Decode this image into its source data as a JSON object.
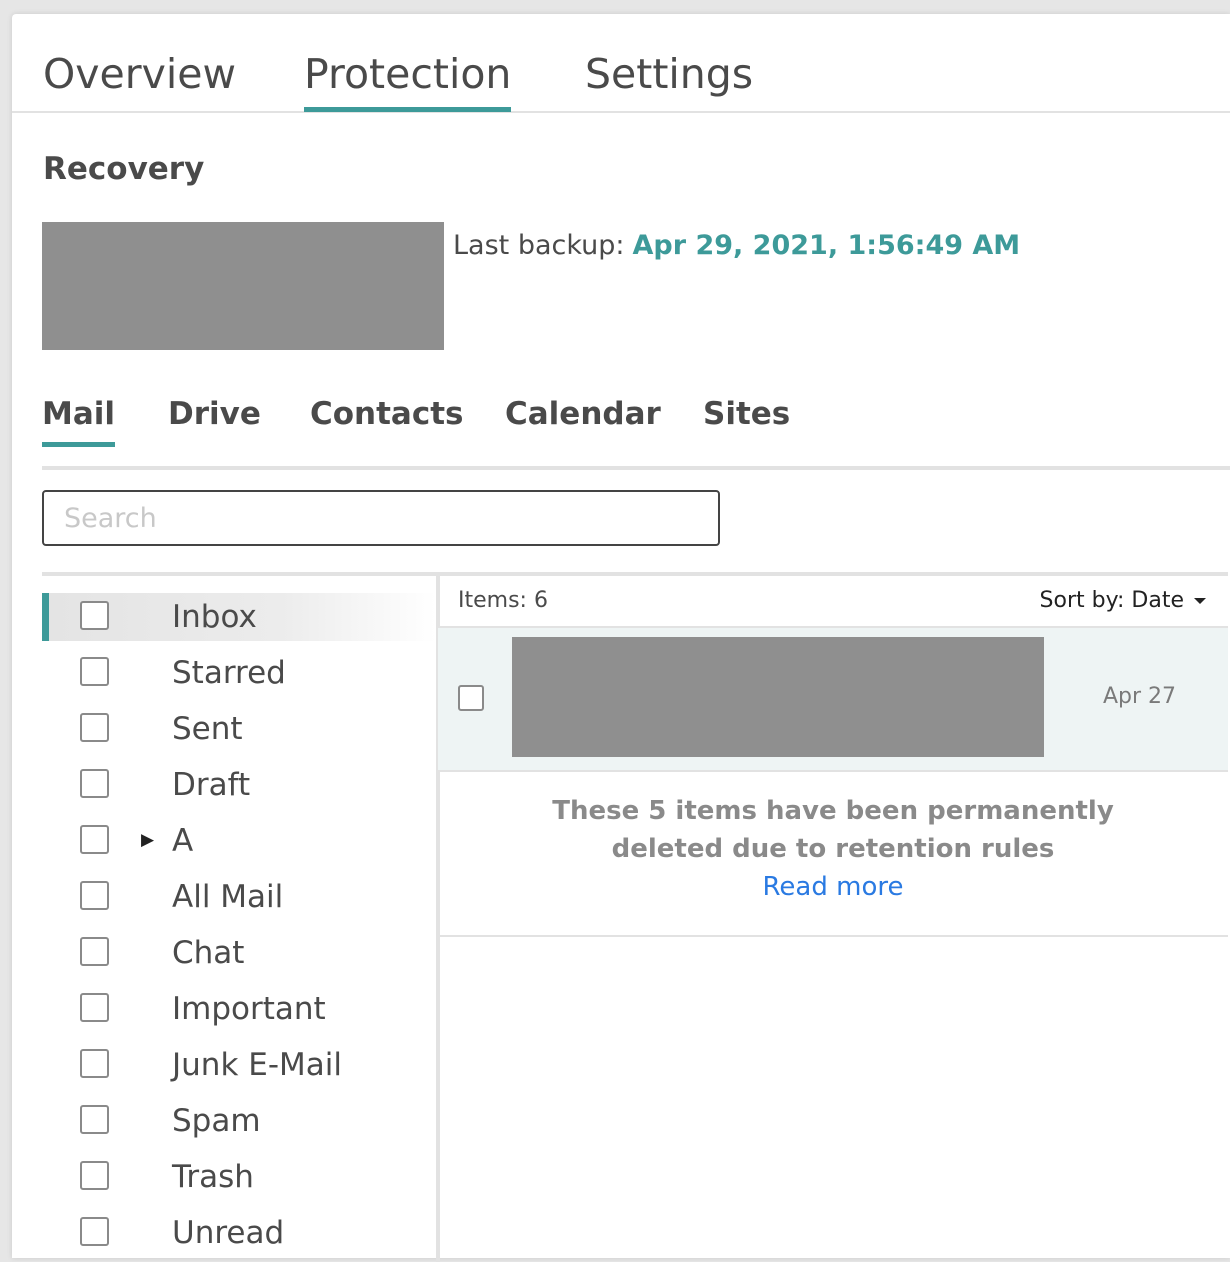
{
  "tabs": [
    "Overview",
    "Protection",
    "Settings"
  ],
  "active_tab": "Protection",
  "section_title": "Recovery",
  "last_backup": {
    "label": "Last backup:",
    "value": "Apr 29, 2021, 1:56:49 AM"
  },
  "sub_tabs": [
    "Mail",
    "Drive",
    "Contacts",
    "Calendar",
    "Sites"
  ],
  "active_sub_tab": "Mail",
  "search": {
    "placeholder": "Search"
  },
  "folders": [
    {
      "label": "Inbox",
      "selected": true
    },
    {
      "label": "Starred"
    },
    {
      "label": "Sent"
    },
    {
      "label": "Draft"
    },
    {
      "label": "A",
      "expandable": true
    },
    {
      "label": "All Mail"
    },
    {
      "label": "Chat"
    },
    {
      "label": "Important"
    },
    {
      "label": "Junk E-Mail"
    },
    {
      "label": "Spam"
    },
    {
      "label": "Trash"
    },
    {
      "label": "Unread"
    }
  ],
  "list": {
    "items_count": "Items: 6",
    "sort_by": "Sort by: Date",
    "mail_items": [
      {
        "date": "Apr 27"
      }
    ],
    "retention_message": "These 5 items have been permanently deleted due to retention rules",
    "read_more": "Read more"
  },
  "colors": {
    "accent": "#3d9a99",
    "link": "#2a7ae2",
    "redaction": "#8f8f8f",
    "selected_row": "#eef4f4"
  },
  "icons": {
    "folder_expand": "caret-right-icon",
    "sort_caret": "caret-down-icon"
  }
}
